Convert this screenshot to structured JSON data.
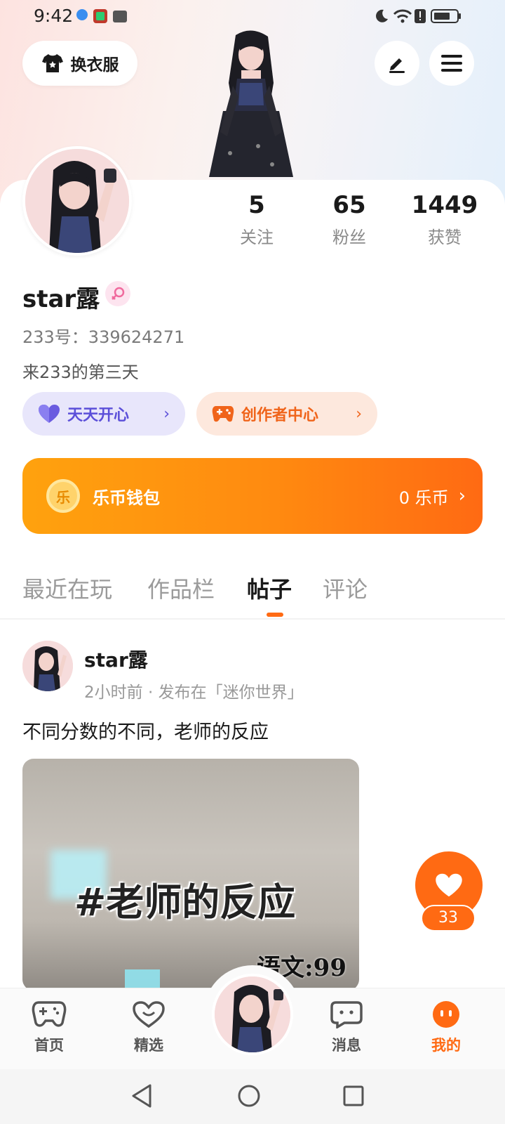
{
  "status_bar": {
    "time": "9:42"
  },
  "header": {
    "outfit_label": "换衣服"
  },
  "stats": [
    {
      "value": "5",
      "label": "关注"
    },
    {
      "value": "65",
      "label": "粉丝"
    },
    {
      "value": "1449",
      "label": "获赞"
    }
  ],
  "profile": {
    "username": "star露",
    "uid": "233号：339624271",
    "bio": "来233的第三天",
    "badge_happy": "天天开心",
    "badge_creator": "创作者中心"
  },
  "wallet": {
    "title": "乐币钱包",
    "balance": "0 乐币",
    "coin_glyph": "乐"
  },
  "tabs": [
    {
      "label": "最近在玩",
      "active": false
    },
    {
      "label": "作品栏",
      "active": false
    },
    {
      "label": "帖子",
      "active": true
    },
    {
      "label": "评论",
      "active": false
    }
  ],
  "post": {
    "author": "star露",
    "meta": "2小时前 · 发布在「迷你世界」",
    "text": "不同分数的不同，老师的反应",
    "media_title": "#老师的反应",
    "media_subtitle": "语文:99",
    "likes": "33"
  },
  "bottom_nav": [
    {
      "label": "首页",
      "icon": "gamepad-icon",
      "active": false
    },
    {
      "label": "精选",
      "icon": "heart-outline-icon",
      "active": false
    },
    {
      "label": "消息",
      "icon": "chat-icon",
      "active": false
    },
    {
      "label": "我的",
      "icon": "smile-icon",
      "active": true
    }
  ],
  "colors": {
    "accent": "#ff6a13",
    "purple": "#5b4fd9"
  }
}
